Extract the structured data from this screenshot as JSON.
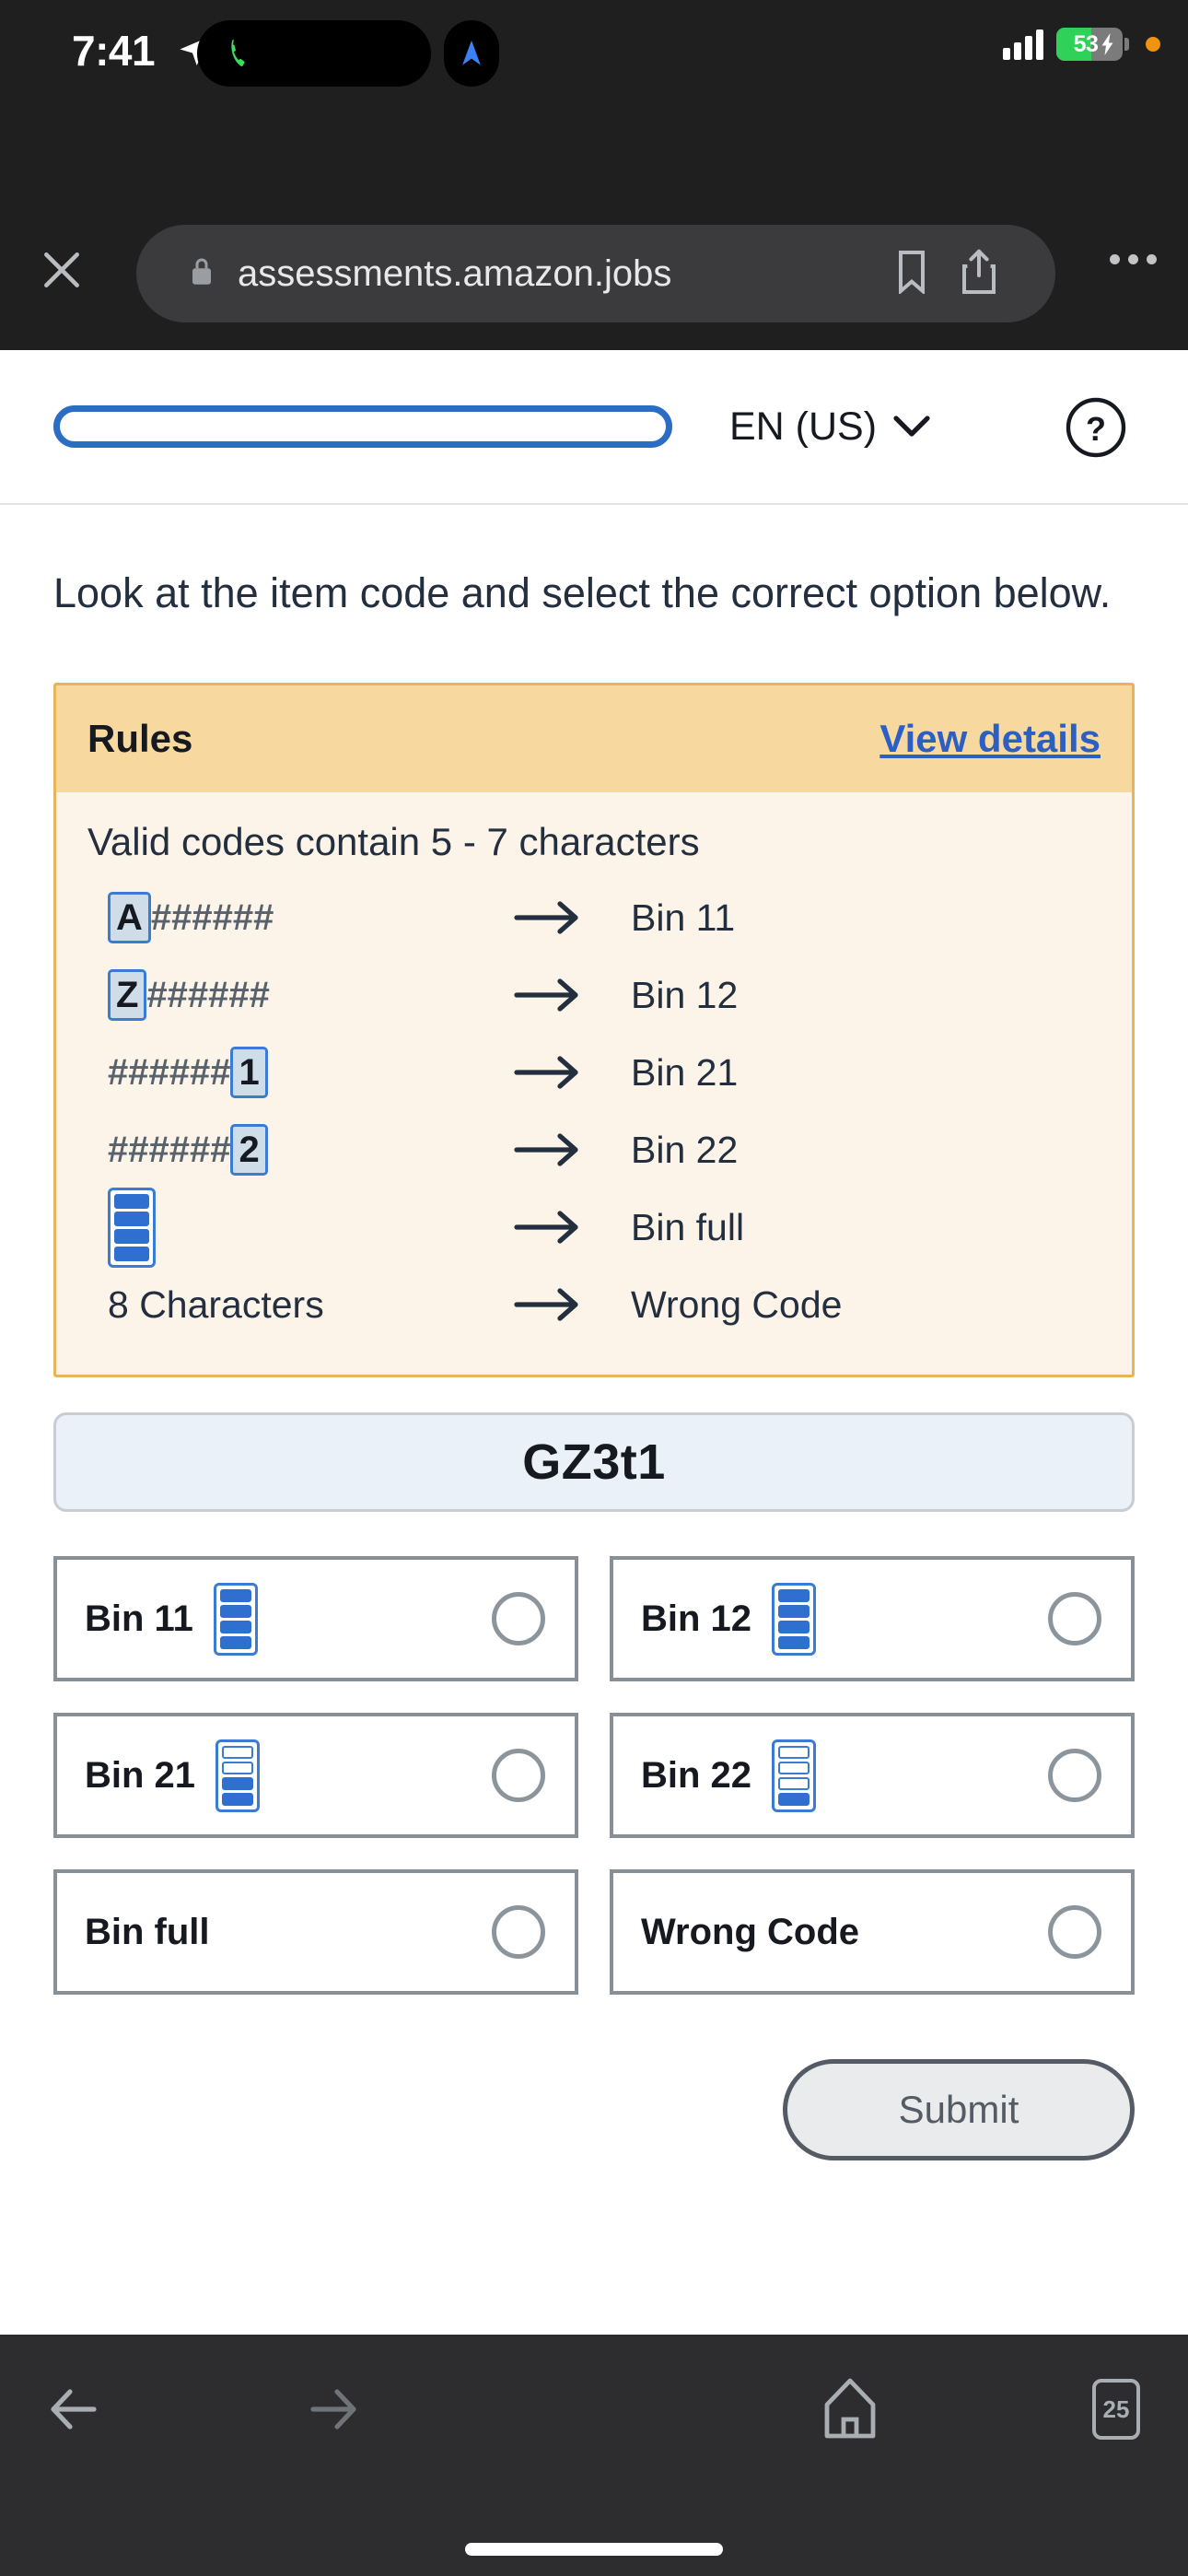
{
  "status_bar": {
    "time": "7:41",
    "location_icon": "location-arrow-icon",
    "phone_icon": "phone-active-icon",
    "navigation_icon": "navigation-arrow-icon",
    "signal_icon": "cellular-signal-icon",
    "battery_percent": "53",
    "battery_charging": true,
    "privacy_dot": "orange-recording-dot"
  },
  "browser_top": {
    "close_label": "×",
    "lock_icon": "lock-icon",
    "url": "assessments.amazon.jobs",
    "bookmark_icon": "bookmark-icon",
    "share_icon": "share-icon",
    "more_icon": "more-options-icon"
  },
  "page_header": {
    "progress_percent": 0,
    "language": "EN (US)",
    "chevron": "chevron-down-icon",
    "help_icon": "question-mark-circle-icon"
  },
  "main": {
    "prompt": "Look at the item code and select the correct option below.",
    "rules": {
      "title": "Rules",
      "view_details": "View details",
      "valid_codes_text": "Valid codes contain 5 - 7 characters",
      "rows": [
        {
          "type": "pattern",
          "prefix_char": "A",
          "hashes": "######",
          "suffix_char": "",
          "arrow": "arrow-right-icon",
          "target": "Bin 11"
        },
        {
          "type": "pattern",
          "prefix_char": "Z",
          "hashes": "######",
          "suffix_char": "",
          "arrow": "arrow-right-icon",
          "target": "Bin 12"
        },
        {
          "type": "pattern",
          "prefix_char": "",
          "hashes": "######",
          "suffix_char": "1",
          "arrow": "arrow-right-icon",
          "target": "Bin 21"
        },
        {
          "type": "pattern",
          "prefix_char": "",
          "hashes": "######",
          "suffix_char": "2",
          "arrow": "arrow-right-icon",
          "target": "Bin 22"
        },
        {
          "type": "bin-icon",
          "filled_cells": 4,
          "total_cells": 4,
          "arrow": "arrow-right-icon",
          "target": "Bin full"
        },
        {
          "type": "text",
          "text": "8 Characters",
          "arrow": "arrow-right-icon",
          "target": "Wrong Code"
        }
      ]
    },
    "item_code": "GZ3t1",
    "options": [
      {
        "label": "Bin 11",
        "has_icon": true,
        "filled_cells": 4,
        "total_cells": 4,
        "selected": false
      },
      {
        "label": "Bin 12",
        "has_icon": true,
        "filled_cells": 4,
        "total_cells": 4,
        "selected": false
      },
      {
        "label": "Bin 21",
        "has_icon": true,
        "filled_cells": 2,
        "total_cells": 4,
        "selected": false
      },
      {
        "label": "Bin 22",
        "has_icon": true,
        "filled_cells": 1,
        "total_cells": 4,
        "selected": false
      },
      {
        "label": "Bin full",
        "has_icon": false,
        "filled_cells": 0,
        "total_cells": 0,
        "selected": false
      },
      {
        "label": "Wrong Code",
        "has_icon": false,
        "filled_cells": 0,
        "total_cells": 0,
        "selected": false
      }
    ],
    "submit_label": "Submit"
  },
  "browser_bottom": {
    "back_icon": "arrow-left-icon",
    "forward_icon": "arrow-right-icon",
    "home_icon": "home-icon",
    "tab_count": "25"
  },
  "colors": {
    "accent_blue": "#2b6cc4",
    "rules_header": "#f7d9a0",
    "rules_body": "#fdf4e9",
    "rules_border": "#e8b45a",
    "code_box_bg": "#eaf1f8",
    "text_dark": "#232f3e",
    "card_border": "#879096",
    "battery_green": "#2fd158"
  }
}
